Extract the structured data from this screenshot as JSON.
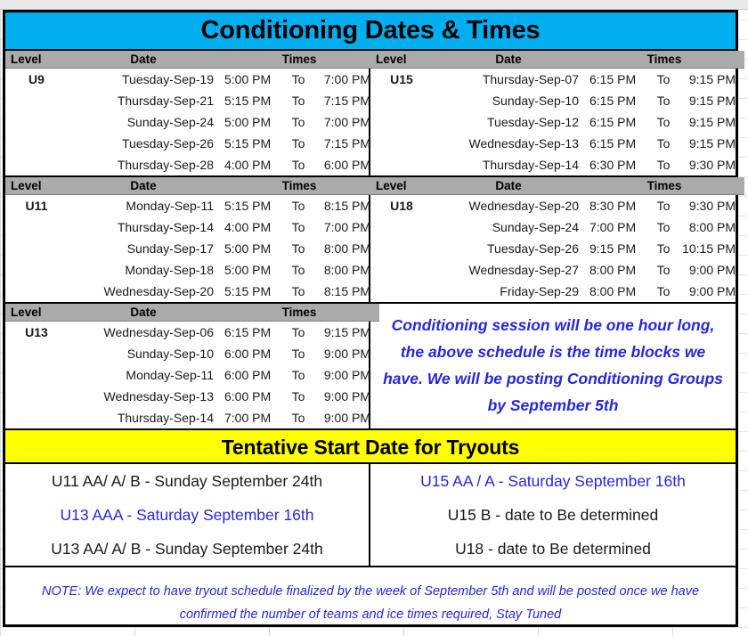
{
  "title_banner": "Conditioning Dates & Times",
  "tryouts_banner": "Tentative Start Date for Tryouts",
  "columns": {
    "level": "Level",
    "date": "Date",
    "times": "Times",
    "to": "To"
  },
  "colors": {
    "title_background": "#00AEEF",
    "tryouts_background": "#FFFF00",
    "table_header_background": "#ABABAB",
    "note_text": "#2727D8",
    "body_text": "#1A1A1A",
    "border": "#000000"
  },
  "schedule": {
    "left": [
      {
        "level": "U9",
        "rows": [
          {
            "date": "Tuesday-Sep-19",
            "start": "5:00 PM",
            "to": "To",
            "end": "7:00 PM"
          },
          {
            "date": "Thursday-Sep-21",
            "start": "5:15 PM",
            "to": "To",
            "end": "7:15 PM"
          },
          {
            "date": "Sunday-Sep-24",
            "start": "5:00 PM",
            "to": "To",
            "end": "7:00 PM"
          },
          {
            "date": "Tuesday-Sep-26",
            "start": "5:15 PM",
            "to": "To",
            "end": "7:15 PM"
          },
          {
            "date": "Thursday-Sep-28",
            "start": "4:00 PM",
            "to": "To",
            "end": "6:00 PM"
          }
        ]
      },
      {
        "level": "U11",
        "rows": [
          {
            "date": "Monday-Sep-11",
            "start": "5:15 PM",
            "to": "To",
            "end": "8:15 PM"
          },
          {
            "date": "Thursday-Sep-14",
            "start": "4:00 PM",
            "to": "To",
            "end": "7:00 PM"
          },
          {
            "date": "Sunday-Sep-17",
            "start": "5:00 PM",
            "to": "To",
            "end": "8:00 PM"
          },
          {
            "date": "Monday-Sep-18",
            "start": "5:00 PM",
            "to": "To",
            "end": "8:00 PM"
          },
          {
            "date": "Wednesday-Sep-20",
            "start": "5:15 PM",
            "to": "To",
            "end": "8:15 PM"
          }
        ]
      },
      {
        "level": "U13",
        "rows": [
          {
            "date": "Wednesday-Sep-06",
            "start": "6:15 PM",
            "to": "To",
            "end": "9:15 PM"
          },
          {
            "date": "Sunday-Sep-10",
            "start": "6:00 PM",
            "to": "To",
            "end": "9:00 PM"
          },
          {
            "date": "Monday-Sep-11",
            "start": "6:00 PM",
            "to": "To",
            "end": "9:00 PM"
          },
          {
            "date": "Wednesday-Sep-13",
            "start": "6:00 PM",
            "to": "To",
            "end": "9:00 PM"
          },
          {
            "date": "Thursday-Sep-14",
            "start": "7:00 PM",
            "to": "To",
            "end": "9:00 PM"
          }
        ]
      }
    ],
    "right": [
      {
        "level": "U15",
        "rows": [
          {
            "date": "Thursday-Sep-07",
            "start": "6:15 PM",
            "to": "To",
            "end": "9:15 PM"
          },
          {
            "date": "Sunday-Sep-10",
            "start": "6:15 PM",
            "to": "To",
            "end": "9:15 PM"
          },
          {
            "date": "Tuesday-Sep-12",
            "start": "6:15 PM",
            "to": "To",
            "end": "9:15 PM"
          },
          {
            "date": "Wednesday-Sep-13",
            "start": "6:15 PM",
            "to": "To",
            "end": "9:15 PM"
          },
          {
            "date": "Thursday-Sep-14",
            "start": "6:30 PM",
            "to": "To",
            "end": "9:30 PM"
          }
        ]
      },
      {
        "level": "U18",
        "rows": [
          {
            "date": "Wednesday-Sep-20",
            "start": "8:30 PM",
            "to": "To",
            "end": "9:30 PM"
          },
          {
            "date": "Sunday-Sep-24",
            "start": "7:00 PM",
            "to": "To",
            "end": "8:00 PM"
          },
          {
            "date": "Tuesday-Sep-26",
            "start": "9:15 PM",
            "to": "To",
            "end": "10:15 PM"
          },
          {
            "date": "Wednesday-Sep-27",
            "start": "8:00 PM",
            "to": "To",
            "end": "9:00 PM"
          },
          {
            "date": "Friday-Sep-29",
            "start": "8:00 PM",
            "to": "To",
            "end": "9:00 PM"
          }
        ]
      }
    ]
  },
  "conditioning_note": "Conditioning session will be one hour long, the above schedule is the time blocks we have. We will be posting Conditioning Groups by September 5th",
  "tryouts": {
    "left": [
      {
        "text": "U11 AA/ A/ B - Sunday September 24th",
        "color": "black"
      },
      {
        "text": "U13 AAA - Saturday September 16th",
        "color": "blue"
      },
      {
        "text": "U13 AA/ A/ B - Sunday September 24th",
        "color": "black"
      }
    ],
    "right": [
      {
        "text": "U15 AA / A - Saturday September 16th",
        "color": "blue"
      },
      {
        "text": "U15 B - date to Be determined",
        "color": "black"
      },
      {
        "text": "U18 - date to Be determined",
        "color": "black"
      }
    ]
  },
  "bottom_note": "NOTE: We expect to have tryout schedule finalized  by the week of September 5th and will be posted once we have confirmed the number of teams and ice times required, Stay Tuned"
}
